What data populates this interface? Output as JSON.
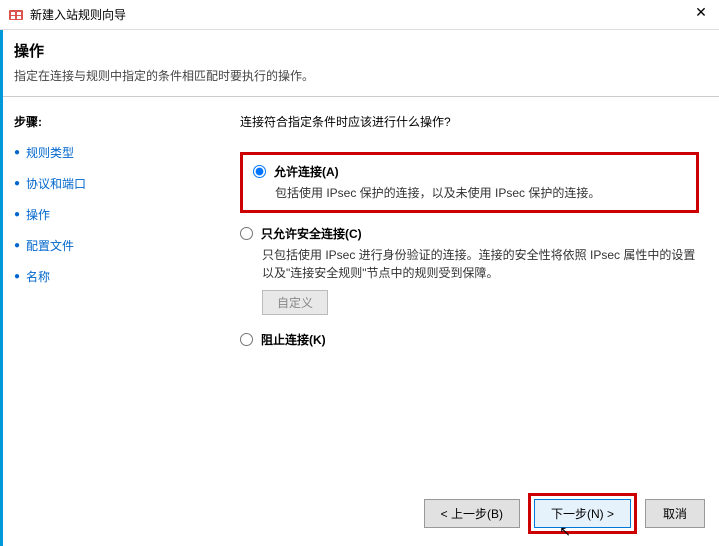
{
  "window": {
    "title": "新建入站规则向导",
    "close": "✕"
  },
  "header": {
    "title": "操作",
    "subtitle": "指定在连接与规则中指定的条件相匹配时要执行的操作。"
  },
  "sidebar": {
    "heading": "步骤:",
    "steps": [
      {
        "label": "规则类型"
      },
      {
        "label": "协议和端口"
      },
      {
        "label": "操作"
      },
      {
        "label": "配置文件"
      },
      {
        "label": "名称"
      }
    ]
  },
  "content": {
    "question": "连接符合指定条件时应该进行什么操作?",
    "options": [
      {
        "label": "允许连接(A)",
        "desc": "包括使用 IPsec 保护的连接，以及未使用 IPsec 保护的连接。",
        "checked": true
      },
      {
        "label": "只允许安全连接(C)",
        "desc": "只包括使用 IPsec 进行身份验证的连接。连接的安全性将依照 IPsec 属性中的设置以及\"连接安全规则\"节点中的规则受到保障。",
        "checked": false,
        "custom_btn": "自定义"
      },
      {
        "label": "阻止连接(K)",
        "checked": false
      }
    ]
  },
  "footer": {
    "back": "< 上一步(B)",
    "next": "下一步(N) >",
    "cancel": "取消"
  }
}
